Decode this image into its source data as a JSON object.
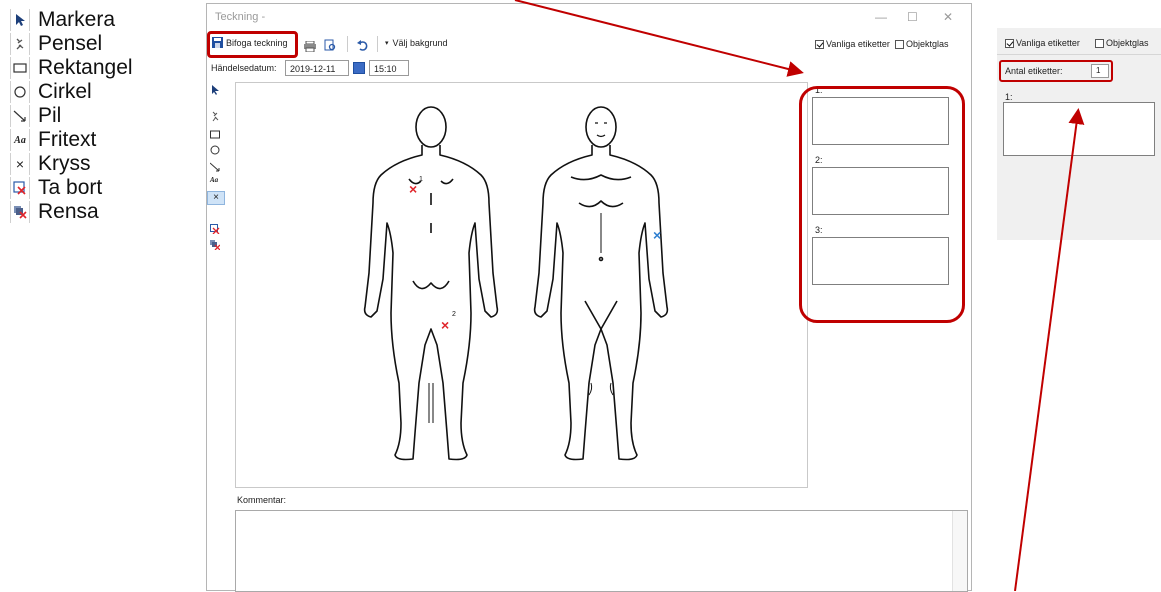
{
  "legend": {
    "items": [
      {
        "icon": "arrow-cursor-icon",
        "label": "Markera"
      },
      {
        "icon": "brush-icon",
        "label": "Pensel"
      },
      {
        "icon": "rectangle-icon",
        "label": "Rektangel"
      },
      {
        "icon": "circle-icon",
        "label": "Cirkel"
      },
      {
        "icon": "arrow-line-icon",
        "label": "Pil"
      },
      {
        "icon": "free-text-icon",
        "label": "Fritext"
      },
      {
        "icon": "cross-icon",
        "label": "Kryss"
      },
      {
        "icon": "delete-icon",
        "label": "Ta bort"
      },
      {
        "icon": "clear-icon",
        "label": "Rensa"
      }
    ],
    "text_icon_glyph": "Aa",
    "cross_glyph": "×"
  },
  "window": {
    "title": "Teckning -",
    "controls": {
      "minimize": "—",
      "maximize": "☐",
      "close": "✕"
    },
    "toolbar": {
      "attach_label": "Bifoga teckning",
      "choose_background_label": "Välj bakgrund",
      "dropdown_glyph": "▾"
    },
    "event_date_label": "Händelsedatum:",
    "date_value": "2019-12-11",
    "time_value": "15:10",
    "regular_labels_checkbox": "Vanliga etiketter",
    "object_glass_checkbox": "Objektglas",
    "regular_labels_checked": true,
    "object_glass_checked": false,
    "label_slots": [
      "1:",
      "2:",
      "3:"
    ],
    "marker_numbers": [
      "1",
      "2"
    ],
    "comment_label": "Kommentar:",
    "cross_glyph": "×",
    "marker_colors": {
      "red": "#e0252b",
      "blue": "#2f7fd0"
    }
  },
  "right_panel": {
    "regular_labels_checkbox": "Vanliga etiketter",
    "object_glass_checkbox": "Objektglas",
    "label_count_label": "Antal etiketter:",
    "label_count_value": "1",
    "label_slot": "1:"
  },
  "highlight_color": "#c00000"
}
